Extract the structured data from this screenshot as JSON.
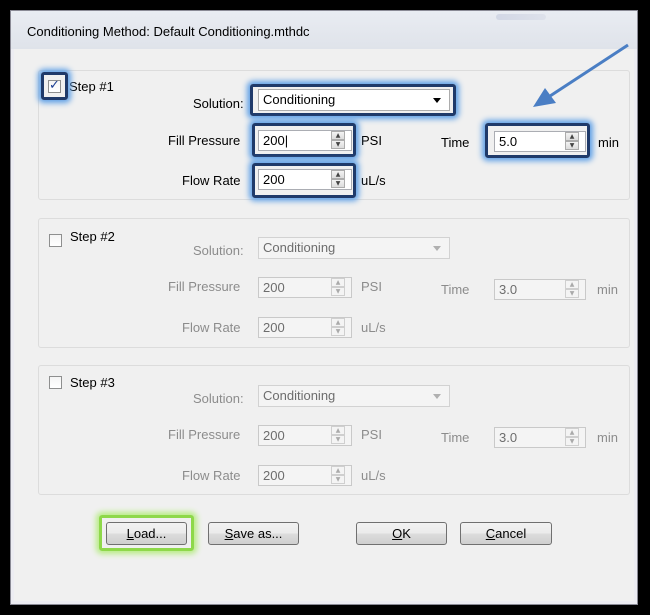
{
  "dialog": {
    "title": "Conditioning Method: Default Conditioning.mthdc"
  },
  "steps": [
    {
      "label": "Step #1",
      "checked": true,
      "solution_label": "Solution:",
      "solution_value": "Conditioning",
      "fill_pressure_label": "Fill Pressure",
      "fill_pressure_value": "200",
      "pressure_unit": "PSI",
      "time_label": "Time",
      "time_value": "5.0",
      "time_unit": "min",
      "flow_rate_label": "Flow Rate",
      "flow_rate_value": "200",
      "flow_unit": "uL/s"
    },
    {
      "label": "Step #2",
      "checked": false,
      "solution_label": "Solution:",
      "solution_value": "Conditioning",
      "fill_pressure_label": "Fill Pressure",
      "fill_pressure_value": "200",
      "pressure_unit": "PSI",
      "time_label": "Time",
      "time_value": "3.0",
      "time_unit": "min",
      "flow_rate_label": "Flow Rate",
      "flow_rate_value": "200",
      "flow_unit": "uL/s"
    },
    {
      "label": "Step #3",
      "checked": false,
      "solution_label": "Solution:",
      "solution_value": "Conditioning",
      "fill_pressure_label": "Fill Pressure",
      "fill_pressure_value": "200",
      "pressure_unit": "PSI",
      "time_label": "Time",
      "time_value": "3.0",
      "time_unit": "min",
      "flow_rate_label": "Flow Rate",
      "flow_rate_value": "200",
      "flow_unit": "uL/s"
    }
  ],
  "buttons": {
    "load": {
      "mnemonic": "L",
      "rest": "oad..."
    },
    "save_as": {
      "mnemonic": "S",
      "rest": "ave as..."
    },
    "ok": {
      "mnemonic": "O",
      "rest": "K"
    },
    "cancel": {
      "mnemonic": "C",
      "rest": "ancel"
    }
  },
  "annotation": {
    "arrow_color": "#4a7ec4",
    "highlight_color": "#5fa0e6",
    "load_highlight_color": "#8ed84a"
  }
}
